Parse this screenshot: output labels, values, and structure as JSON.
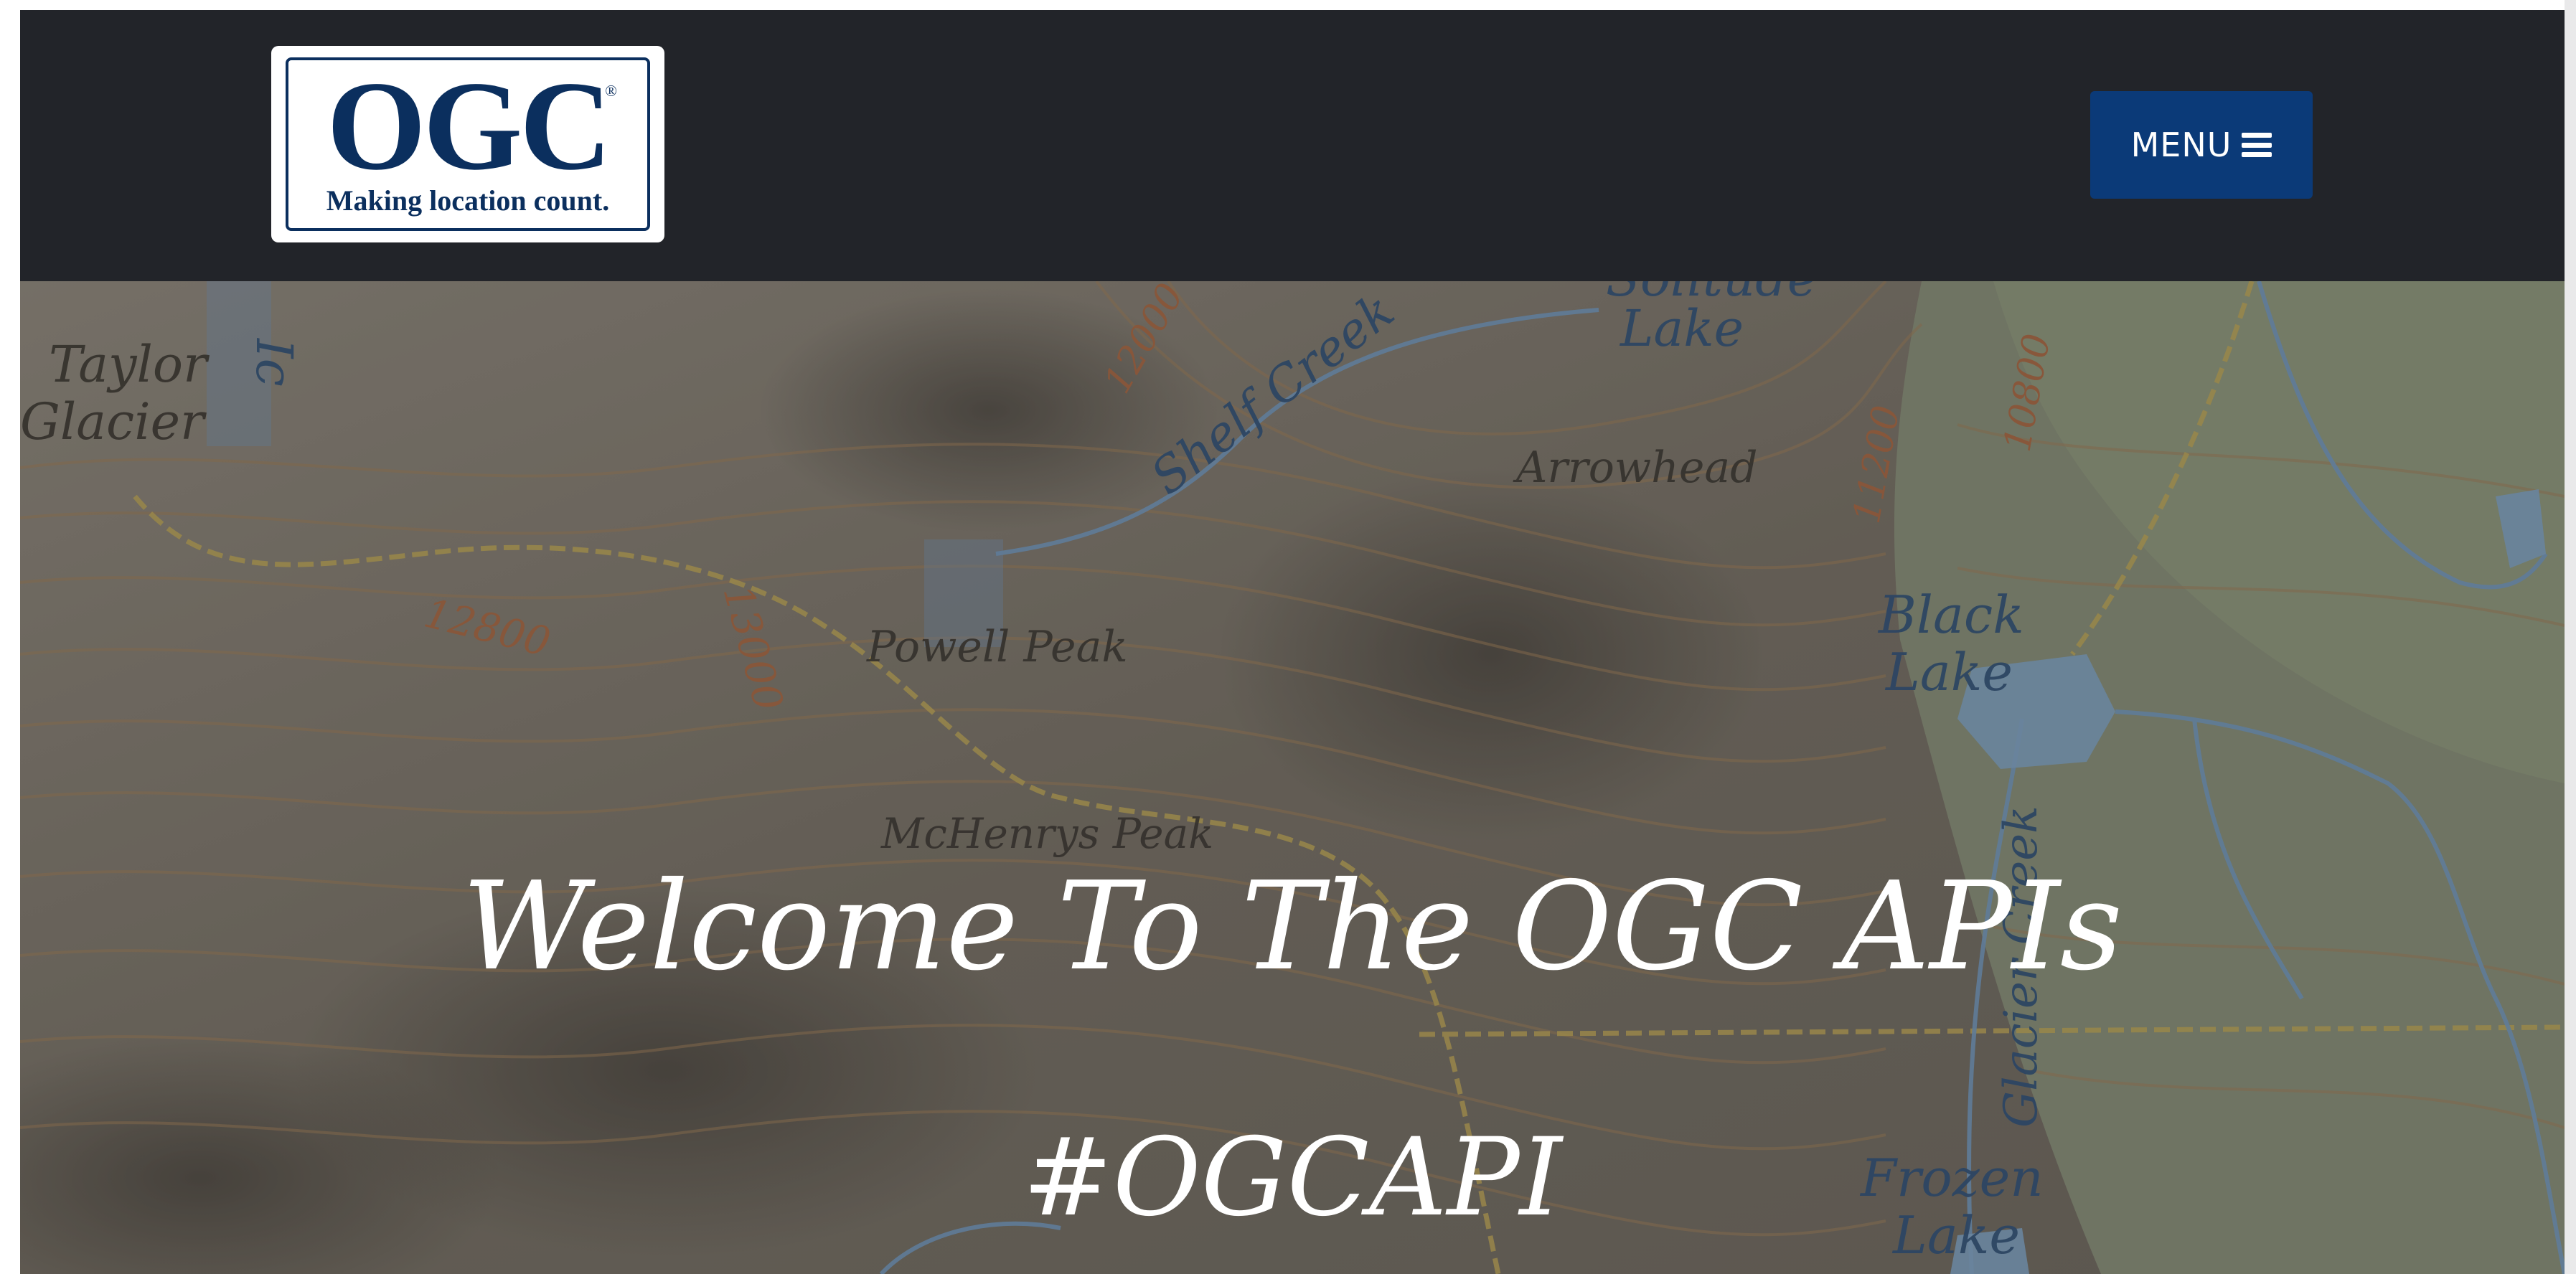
{
  "header": {
    "logo_text": "OGC",
    "logo_registered": "®",
    "logo_tagline": "Making location count.",
    "menu_label": "MENU",
    "menu_icon": "hamburger-icon"
  },
  "hero": {
    "title": "Welcome To The OGC APIs",
    "hashtag": "#OGCAPI",
    "map_labels": {
      "taylor": "Taylor",
      "glacier": "Glacier",
      "shelf_creek": "Shelf Creek",
      "lake_top": "Lake",
      "solitude": "Solitude",
      "arrowhead": "Arrowhead",
      "c12800": "12800",
      "c13000": "13000",
      "c12000": "12000",
      "c11200": "11200",
      "c10800": "10800",
      "powell_peak": "Powell Peak",
      "black": "Black",
      "black_lake": "Lake",
      "mchenrys_peak": "McHenrys Peak",
      "glacier_creek": "Glacier Creek",
      "frozen": "Frozen",
      "frozen_lake": "Lake"
    }
  },
  "colors": {
    "navbar_bg": "#222429",
    "menu_button_bg": "#0b3a78",
    "logo_blue": "#0b2f5e"
  }
}
